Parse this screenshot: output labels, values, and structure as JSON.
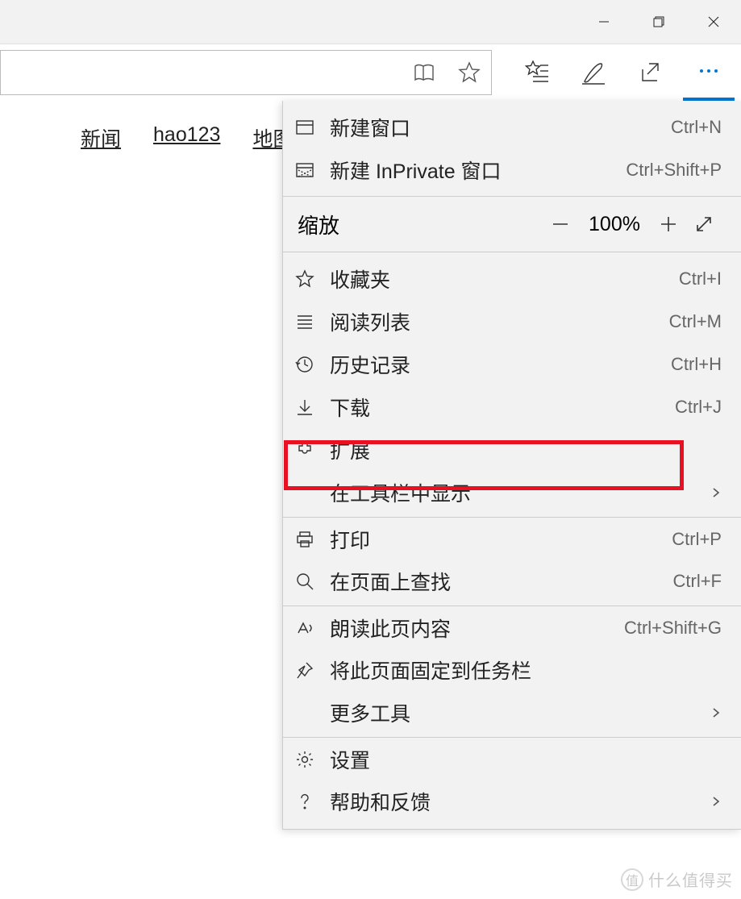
{
  "page": {
    "links": [
      "新闻",
      "hao123",
      "地图"
    ]
  },
  "zoom": {
    "label": "缩放",
    "value": "100%"
  },
  "menu": {
    "new_window": {
      "label": "新建窗口",
      "shortcut": "Ctrl+N"
    },
    "new_inprivate": {
      "label": "新建 InPrivate 窗口",
      "shortcut": "Ctrl+Shift+P"
    },
    "favorites": {
      "label": "收藏夹",
      "shortcut": "Ctrl+I"
    },
    "reading_list": {
      "label": "阅读列表",
      "shortcut": "Ctrl+M"
    },
    "history": {
      "label": "历史记录",
      "shortcut": "Ctrl+H"
    },
    "downloads": {
      "label": "下载",
      "shortcut": "Ctrl+J"
    },
    "extensions": {
      "label": "扩展"
    },
    "show_in_toolbar": {
      "label": "在工具栏中显示"
    },
    "print": {
      "label": "打印",
      "shortcut": "Ctrl+P"
    },
    "find": {
      "label": "在页面上查找",
      "shortcut": "Ctrl+F"
    },
    "read_aloud": {
      "label": "朗读此页内容",
      "shortcut": "Ctrl+Shift+G"
    },
    "pin_taskbar": {
      "label": "将此页面固定到任务栏"
    },
    "more_tools": {
      "label": "更多工具"
    },
    "settings": {
      "label": "设置"
    },
    "help": {
      "label": "帮助和反馈"
    }
  },
  "watermark": {
    "text": "什么值得买",
    "badge": "值"
  }
}
